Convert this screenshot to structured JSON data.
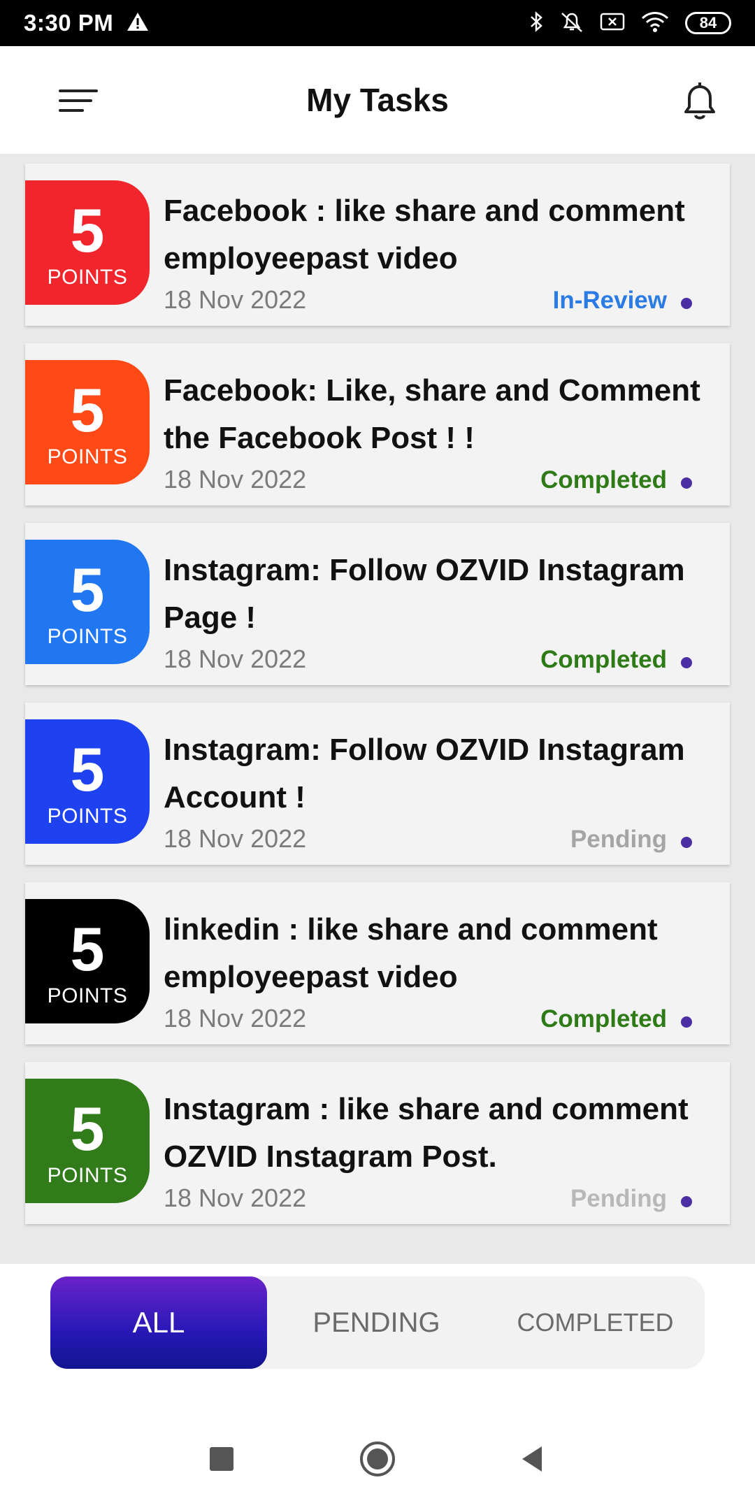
{
  "status_bar": {
    "time": "3:30 PM",
    "battery": "84",
    "icons": [
      "warning-icon",
      "bluetooth-icon",
      "mute-icon",
      "close-box-icon",
      "wifi-icon",
      "battery-icon"
    ]
  },
  "app_bar": {
    "title": "My Tasks",
    "icons": [
      "menu-icon",
      "bell-icon"
    ]
  },
  "tasks": [
    {
      "points": "5",
      "points_label": "POINTS",
      "badge_color": "#f1262d",
      "title": "Facebook : like  share and comment  employeepast video",
      "date": "18 Nov 2022",
      "status": "In-Review",
      "status_color": "#2a7be4"
    },
    {
      "points": "5",
      "points_label": "POINTS",
      "badge_color": "#ff4a17",
      "title": "Facebook: Like, share and Comment the Facebook Post ! !",
      "date": "18 Nov 2022",
      "status": "Completed",
      "status_color": "#2d7a16"
    },
    {
      "points": "5",
      "points_label": "POINTS",
      "badge_color": "#2177f2",
      "title": "Instagram: Follow OZVID Instagram Page !",
      "date": "18 Nov 2022",
      "status": "Completed",
      "status_color": "#2d7a16"
    },
    {
      "points": "5",
      "points_label": "POINTS",
      "badge_color": "#1e42f0",
      "title": "Instagram: Follow OZVID Instagram Account !",
      "date": "18 Nov 2022",
      "status": "Pending",
      "status_color": "#a5a5a5"
    },
    {
      "points": "5",
      "points_label": "POINTS",
      "badge_color": "#000000",
      "title": "linkedin : like  share and comment employeepast video",
      "date": "18 Nov 2022",
      "status": "Completed",
      "status_color": "#2d7a16"
    },
    {
      "points": "5",
      "points_label": "POINTS",
      "badge_color": "#317b1a",
      "title": "Instagram : like share and comment OZVID Instagram Post.",
      "date": "18 Nov 2022",
      "status": "Pending",
      "status_color": "#b8b8b8"
    }
  ],
  "filters": {
    "all": "ALL",
    "pending": "PENDING",
    "completed": "COMPLETED",
    "selected": "ALL"
  },
  "nav_bar": {
    "icons": [
      "recents-icon",
      "home-icon",
      "back-icon"
    ]
  }
}
